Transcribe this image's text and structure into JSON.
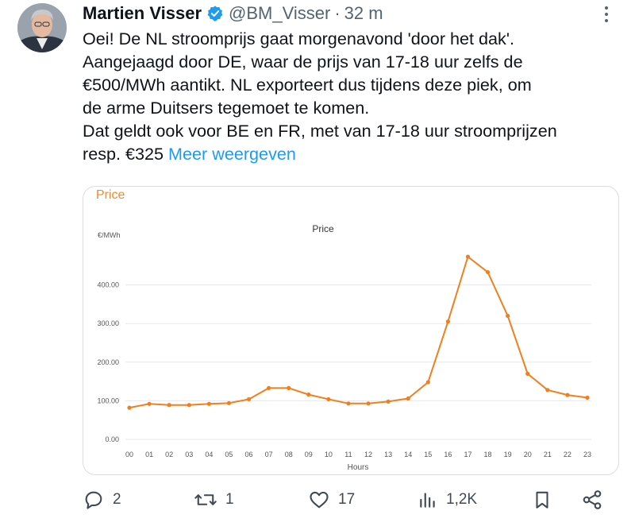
{
  "tweet": {
    "author_name": "Martien Visser",
    "handle": "@BM_Visser",
    "separator": "·",
    "time": "32 m",
    "lines": [
      "Oei! De NL stroomprijs gaat morgenavond 'door het dak'.",
      "Aangejaagd door DE, waar de prijs van 17-18 uur zelfs de",
      "€500/MWh aantikt. NL exporteert dus tijdens deze piek, om",
      "de arme Duitsers tegemoet te komen.",
      "Dat geldt ook voor BE en FR, met van 17-18 uur stroomprijzen",
      "resp. €325"
    ],
    "show_more": "Meer weergeven"
  },
  "card": {
    "title": "Price"
  },
  "chart_data": {
    "type": "line",
    "title": "Price",
    "ylabel": "€/MWh",
    "xlabel": "Hours",
    "x": [
      "00",
      "01",
      "02",
      "03",
      "04",
      "05",
      "06",
      "07",
      "08",
      "09",
      "10",
      "11",
      "12",
      "13",
      "14",
      "15",
      "16",
      "17",
      "18",
      "19",
      "20",
      "21",
      "22",
      "23"
    ],
    "series": [
      {
        "values": [
          82,
          92,
          89,
          89,
          92,
          94,
          104,
          133,
          133,
          116,
          104,
          93,
          93,
          98,
          106,
          148,
          305,
          473,
          433,
          320,
          170,
          128,
          115,
          108
        ]
      }
    ],
    "y_ticks": [
      "0.00",
      "100.00",
      "200.00",
      "300.00",
      "400.00"
    ],
    "ylim": [
      0,
      500
    ],
    "grid": true,
    "line_color": "#f07f1e"
  },
  "actions": {
    "replies": "2",
    "retweets": "1",
    "likes": "17",
    "views": "1,2K"
  }
}
